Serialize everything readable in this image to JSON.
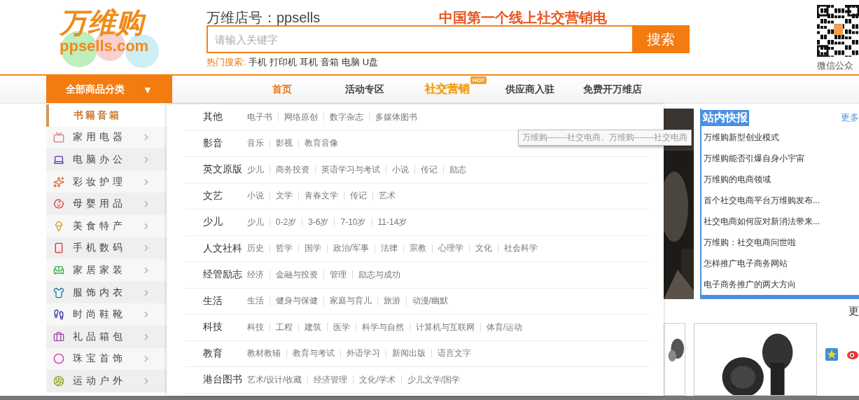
{
  "logo": {
    "name": "万维购",
    "domain": "ppsells.com"
  },
  "store_label": "万维店号：ppsells",
  "slogan": "中国第一个线上社交营销电",
  "search": {
    "placeholder": "请输入关键字",
    "button": "搜索"
  },
  "hot_search": {
    "label": "热门搜索:",
    "terms": [
      "手机",
      "打印机",
      "耳机",
      "音箱",
      "电脑",
      "U盘"
    ]
  },
  "qr_caption": "微信公众",
  "category_button": {
    "label": "全部商品分类",
    "arrow": "▼"
  },
  "nav": [
    {
      "label": "首页",
      "selected": true,
      "kind": "plain"
    },
    {
      "label": "活动专区",
      "selected": false,
      "kind": "plain"
    },
    {
      "label": "社交营销",
      "selected": false,
      "kind": "hot",
      "badge": "HOT"
    },
    {
      "label": "供应商入驻",
      "selected": false,
      "kind": "plain"
    },
    {
      "label": "免费开万维店",
      "selected": false,
      "kind": "plain"
    }
  ],
  "sidebar": [
    {
      "label": "书籍音箱",
      "selected": true
    },
    {
      "label": "家用电器",
      "selected": false
    },
    {
      "label": "电脑办公",
      "selected": false
    },
    {
      "label": "彩妆护理",
      "selected": false
    },
    {
      "label": "母婴用品",
      "selected": false
    },
    {
      "label": "美食特产",
      "selected": false
    },
    {
      "label": "手机数码",
      "selected": false
    },
    {
      "label": "家居家装",
      "selected": false
    },
    {
      "label": "服饰内衣",
      "selected": false
    },
    {
      "label": "时尚鞋靴",
      "selected": false
    },
    {
      "label": "礼品箱包",
      "selected": false
    },
    {
      "label": "珠宝首饰",
      "selected": false
    },
    {
      "label": "运动户外",
      "selected": false
    }
  ],
  "categories": [
    {
      "name": "其他",
      "links": [
        "电子书",
        "网络原创",
        "数字杂志",
        "多媒体图书"
      ]
    },
    {
      "name": "影音",
      "links": [
        "音乐",
        "影视",
        "教育音像"
      ]
    },
    {
      "name": "英文原版",
      "links": [
        "少儿",
        "商务投资",
        "英语学习与考试",
        "小说",
        "传记",
        "励志"
      ]
    },
    {
      "name": "文艺",
      "links": [
        "小说",
        "文学",
        "青春文学",
        "传记",
        "艺术"
      ]
    },
    {
      "name": "少儿",
      "links": [
        "少儿",
        "0-2岁",
        "3-6岁",
        "7-10岁",
        "11-14岁"
      ]
    },
    {
      "name": "人文社科",
      "links": [
        "历史",
        "哲学",
        "国学",
        "政治/军事",
        "法律",
        "宗教",
        "心理学",
        "文化",
        "社会科学"
      ]
    },
    {
      "name": "经管励志",
      "links": [
        "经济",
        "金融与投资",
        "管理",
        "励志与成功"
      ]
    },
    {
      "name": "生活",
      "links": [
        "生活",
        "健身与保健",
        "家庭与育儿",
        "旅游",
        "动漫/幽默"
      ]
    },
    {
      "name": "科技",
      "links": [
        "科技",
        "工程",
        "建筑",
        "医学",
        "科学与自然",
        "计算机与互联网",
        "体育/运动"
      ]
    },
    {
      "name": "教育",
      "links": [
        "教材教辅",
        "教育与考试",
        "外语学习",
        "新闻出版",
        "语言文字"
      ]
    },
    {
      "name": "港台图书",
      "links": [
        "艺术/设计/收藏",
        "经济管理",
        "文化/学术",
        "少儿文学/国学"
      ]
    }
  ],
  "tooltip": "万维购-------社交电商、万维购-------社交电商",
  "news": {
    "title": "站内快报",
    "more": "更多",
    "items": [
      "万维购新型创业模式",
      "万维购能否引爆自身小宇宙",
      "万维购的电商领域",
      "首个社交电商平台万维购发布...",
      "社交电商如何应对新消法带来...",
      "万维购：社交电商问世啦",
      "怎样推广电子商务网站",
      "电子商务推广的两大方向"
    ]
  },
  "products_more": "更"
}
